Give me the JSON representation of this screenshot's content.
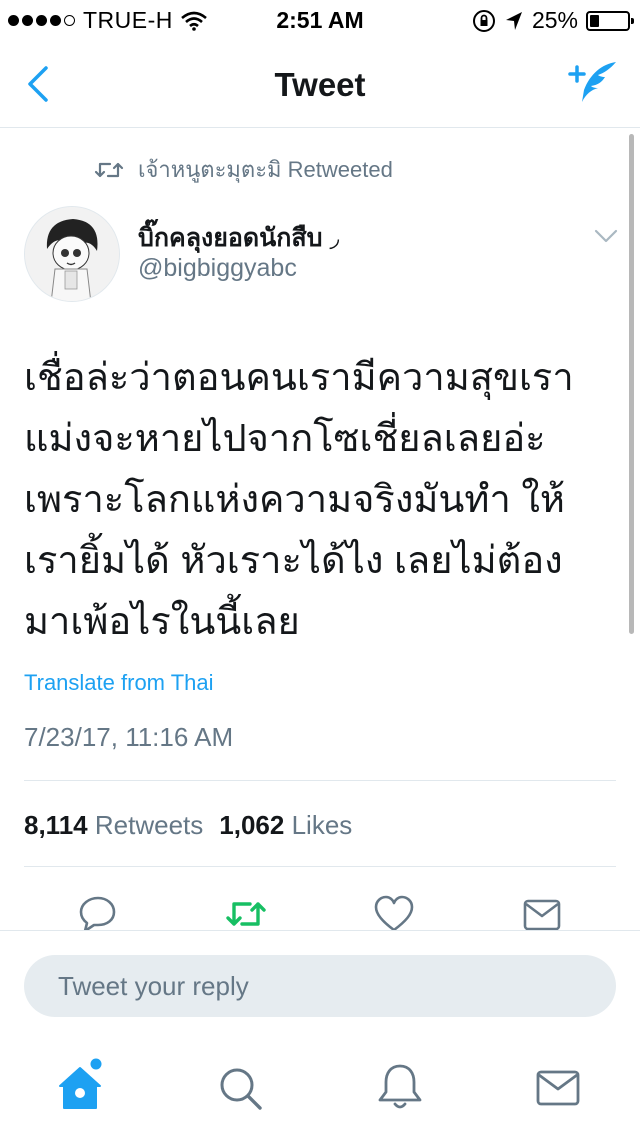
{
  "status_bar": {
    "carrier": "TRUE-H",
    "time": "2:51 AM",
    "battery_percent": "25%",
    "battery_level": 0.25
  },
  "nav": {
    "title": "Tweet"
  },
  "tweet": {
    "retweeted_by": "เจ้าหนูตะมุตะมิ Retweeted",
    "display_name": "บิ๊กคลุงยอดนักสืบ ◞",
    "username": "@bigbiggyabc",
    "text_lines": [
      "เชื่อล่ะว่าตอนคนเรามีความสุขเรา",
      "แม่งจะหายไปจากโซเชี่ยลเลยอ่ะ",
      "เพราะโลกแห่งความจริงมันทำ ให้",
      "เรายิ้มได้ หัวเราะได้ไง เลยไม่ต้อง",
      "มาเพ้อไรในนี้เลย"
    ],
    "translate_label": "Translate from Thai",
    "timestamp": "7/23/17, 11:16 AM",
    "retweet_count": "8,114",
    "retweet_label": "Retweets",
    "like_count": "1,062",
    "like_label": "Likes"
  },
  "reply": {
    "placeholder": "Tweet your reply",
    "value": ""
  },
  "icons": {
    "back": "chevron-left-icon",
    "compose": "compose-tweet-icon",
    "retweet_context": "retweet-icon",
    "caret": "chevron-down-icon",
    "reply": "reply-icon",
    "retweet": "retweet-icon",
    "like": "heart-icon",
    "dm": "envelope-icon",
    "tab_home": "home-icon",
    "tab_search": "search-icon",
    "tab_notifications": "bell-icon",
    "tab_messages": "envelope-icon"
  },
  "colors": {
    "accent": "#1da1f2",
    "retweet_active": "#17bf63",
    "secondary_text": "#657786",
    "primary_text": "#14171a"
  }
}
